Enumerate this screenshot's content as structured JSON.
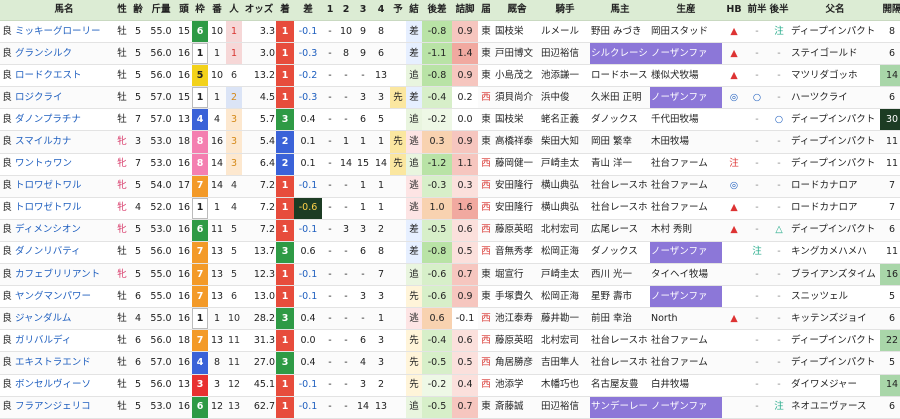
{
  "headers": [
    "",
    "馬名",
    "性",
    "齢",
    "斤量",
    "頭",
    "枠",
    "番",
    "人",
    "オッズ",
    "着",
    "差",
    "1",
    "2",
    "3",
    "4",
    "予",
    "結",
    "後差",
    "詰脚",
    "届",
    "厩舎",
    "騎手",
    "馬主",
    "生産",
    "HB",
    "前半",
    "後半",
    "父名",
    "開隔"
  ],
  "colors": {
    "header_bg": "#dcecd4",
    "link": "#1f5fbf",
    "mare": "#d83a6a",
    "gate1": "#ffffff",
    "gate2": "#222222",
    "gate3": "#e83030",
    "gate4": "#3a62d8",
    "gate5": "#f3d21a",
    "gate6": "#2e9a45",
    "gate7": "#f39a28",
    "gate8": "#f47fb0"
  },
  "rows": [
    {
      "track": "良",
      "name": "ミッキーグローリー",
      "sex": "牡",
      "age": "5",
      "wt": "55.0",
      "heads": "15",
      "waku": "6",
      "ban": "10",
      "pop": "1",
      "odds": "3.3",
      "fin": "1",
      "diff": "-0.1",
      "c1": "-",
      "c2": "10",
      "c3": "9",
      "c4": "8",
      "yo": "",
      "res": "差",
      "kousa": "-0.8",
      "tsume": "0.9",
      "todoke": "東",
      "stable": "国枝栄",
      "jockey": "ルメール",
      "owner": "野田 みづき",
      "breeder": "岡田スタッド",
      "hb": "▲",
      "front": "-",
      "back": "注",
      "sire": "ディープインパクト",
      "gap": "8"
    },
    {
      "track": "良",
      "name": "グランシルク",
      "sex": "牡",
      "age": "5",
      "wt": "56.0",
      "heads": "16",
      "waku": "1",
      "ban": "1",
      "pop": "1",
      "odds": "3.0",
      "fin": "1",
      "diff": "-0.3",
      "c1": "-",
      "c2": "8",
      "c3": "9",
      "c4": "6",
      "yo": "",
      "res": "差",
      "kousa": "-1.1",
      "tsume": "1.4",
      "todoke": "東",
      "stable": "戸田博文",
      "jockey": "田辺裕信",
      "owner": "シルクレーシ",
      "breeder": "ノーザンファ",
      "hb": "▲",
      "front": "-",
      "back": "-",
      "sire": "ステイゴールド",
      "gap": "6"
    },
    {
      "track": "良",
      "name": "ロードクエスト",
      "sex": "牡",
      "age": "5",
      "wt": "56.0",
      "heads": "16",
      "waku": "5",
      "ban": "10",
      "pop": "6",
      "odds": "13.2",
      "fin": "1",
      "diff": "-0.2",
      "c1": "-",
      "c2": "-",
      "c3": "-",
      "c4": "13",
      "yo": "",
      "res": "追",
      "kousa": "-0.8",
      "tsume": "0.9",
      "todoke": "東",
      "stable": "小島茂之",
      "jockey": "池添謙一",
      "owner": "ロードホース",
      "breeder": "様似犬牧場",
      "hb": "▲",
      "front": "-",
      "back": "-",
      "sire": "マツリダゴッホ",
      "gap": "14"
    },
    {
      "track": "良",
      "name": "ロジクライ",
      "sex": "牡",
      "age": "5",
      "wt": "57.0",
      "heads": "15",
      "waku": "1",
      "ban": "1",
      "pop": "2",
      "odds": "4.5",
      "fin": "1",
      "diff": "-0.3",
      "c1": "-",
      "c2": "-",
      "c3": "3",
      "c4": "3",
      "yo": "先",
      "res": "差",
      "kousa": "-0.4",
      "tsume": "0.2",
      "todoke": "西",
      "stable": "須貝尚介",
      "jockey": "浜中俊",
      "owner": "久米田 正明",
      "breeder": "ノーザンファ",
      "hb": "◎",
      "front": "○",
      "back": "-",
      "sire": "ハーツクライ",
      "gap": "6"
    },
    {
      "track": "良",
      "name": "ダノンプラチナ",
      "sex": "牡",
      "age": "7",
      "wt": "57.0",
      "heads": "13",
      "waku": "4",
      "ban": "4",
      "pop": "3",
      "odds": "5.7",
      "fin": "3",
      "diff": "0.4",
      "c1": "-",
      "c2": "-",
      "c3": "6",
      "c4": "5",
      "yo": "",
      "res": "追",
      "kousa": "-0.2",
      "tsume": "0.0",
      "todoke": "東",
      "stable": "国枝栄",
      "jockey": "蛯名正義",
      "owner": "ダノックス",
      "breeder": "千代田牧場",
      "hb": "",
      "front": "-",
      "back": "○",
      "sire": "ディープインパクト",
      "gap": "30"
    },
    {
      "track": "良",
      "name": "スマイルカナ",
      "sex": "牝",
      "age": "3",
      "wt": "53.0",
      "heads": "18",
      "waku": "8",
      "ban": "16",
      "pop": "3",
      "odds": "5.4",
      "fin": "2",
      "diff": "0.1",
      "c1": "-",
      "c2": "1",
      "c3": "1",
      "c4": "1",
      "yo": "先",
      "res": "逃",
      "kousa": "0.3",
      "tsume": "0.9",
      "todoke": "東",
      "stable": "高橋祥泰",
      "jockey": "柴田大知",
      "owner": "岡田 繁幸",
      "breeder": "木田牧場",
      "hb": "",
      "front": "-",
      "back": "-",
      "sire": "ディープインパクト",
      "gap": "11"
    },
    {
      "track": "良",
      "name": "ワントゥワン",
      "sex": "牝",
      "age": "7",
      "wt": "53.0",
      "heads": "16",
      "waku": "8",
      "ban": "14",
      "pop": "3",
      "odds": "6.4",
      "fin": "2",
      "diff": "0.1",
      "c1": "-",
      "c2": "14",
      "c3": "15",
      "c4": "14",
      "yo": "先",
      "res": "追",
      "kousa": "-1.2",
      "tsume": "1.1",
      "todoke": "西",
      "stable": "藤岡健一",
      "jockey": "戸崎圭太",
      "owner": "青山 洋一",
      "breeder": "社台ファーム",
      "hb": "注",
      "front": "-",
      "back": "-",
      "sire": "ディープインパクト",
      "gap": "11"
    },
    {
      "track": "良",
      "name": "トロワゼトワル",
      "sex": "牝",
      "age": "5",
      "wt": "54.0",
      "heads": "17",
      "waku": "7",
      "ban": "14",
      "pop": "4",
      "odds": "7.2",
      "fin": "1",
      "diff": "-0.1",
      "c1": "-",
      "c2": "-",
      "c3": "1",
      "c4": "1",
      "yo": "",
      "res": "逃",
      "kousa": "-0.3",
      "tsume": "0.3",
      "todoke": "西",
      "stable": "安田隆行",
      "jockey": "横山典弘",
      "owner": "社台レースホ",
      "breeder": "社台ファーム",
      "hb": "◎",
      "front": "-",
      "back": "-",
      "sire": "ロードカナロア",
      "gap": "7"
    },
    {
      "track": "良",
      "name": "トロワゼトワル",
      "sex": "牝",
      "age": "4",
      "wt": "52.0",
      "heads": "16",
      "waku": "1",
      "ban": "1",
      "pop": "4",
      "odds": "7.2",
      "fin": "1",
      "diff": "-0.6",
      "c1": "-",
      "c2": "-",
      "c3": "1",
      "c4": "1",
      "yo": "",
      "res": "逃",
      "kousa": "1.0",
      "tsume": "1.6",
      "todoke": "西",
      "stable": "安田隆行",
      "jockey": "横山典弘",
      "owner": "社台レースホ",
      "breeder": "社台ファーム",
      "hb": "▲",
      "front": "-",
      "back": "-",
      "sire": "ロードカナロア",
      "gap": "7"
    },
    {
      "track": "良",
      "name": "ディメンシオン",
      "sex": "牝",
      "age": "5",
      "wt": "53.0",
      "heads": "16",
      "waku": "6",
      "ban": "11",
      "pop": "5",
      "odds": "7.2",
      "fin": "1",
      "diff": "-0.1",
      "c1": "-",
      "c2": "3",
      "c3": "3",
      "c4": "2",
      "yo": "",
      "res": "差",
      "kousa": "-0.5",
      "tsume": "0.6",
      "todoke": "西",
      "stable": "藤原英昭",
      "jockey": "北村宏司",
      "owner": "広尾レース",
      "breeder": "木村 秀則",
      "hb": "▲",
      "front": "-",
      "back": "△",
      "sire": "ディープインパクト",
      "gap": "6"
    },
    {
      "track": "良",
      "name": "ダノンリバティ",
      "sex": "牡",
      "age": "5",
      "wt": "56.0",
      "heads": "16",
      "waku": "7",
      "ban": "13",
      "pop": "5",
      "odds": "13.7",
      "fin": "3",
      "diff": "0.6",
      "c1": "-",
      "c2": "-",
      "c3": "6",
      "c4": "8",
      "yo": "",
      "res": "差",
      "kousa": "-0.8",
      "tsume": "0.5",
      "todoke": "西",
      "stable": "音無秀孝",
      "jockey": "松岡正海",
      "owner": "ダノックス",
      "breeder": "ノーザンファ",
      "hb": "",
      "front": "注",
      "back": "-",
      "sire": "キングカメハメハ",
      "gap": "11"
    },
    {
      "track": "良",
      "name": "カフェブリリアント",
      "sex": "牝",
      "age": "5",
      "wt": "55.0",
      "heads": "16",
      "waku": "7",
      "ban": "13",
      "pop": "5",
      "odds": "12.3",
      "fin": "1",
      "diff": "-0.1",
      "c1": "-",
      "c2": "-",
      "c3": "-",
      "c4": "7",
      "yo": "",
      "res": "追",
      "kousa": "-0.6",
      "tsume": "0.7",
      "todoke": "東",
      "stable": "堀宣行",
      "jockey": "戸崎圭太",
      "owner": "西川 光一",
      "breeder": "タイヘイ牧場",
      "hb": "",
      "front": "-",
      "back": "-",
      "sire": "ブライアンズタイム",
      "gap": "16"
    },
    {
      "track": "良",
      "name": "ヤングマンパワー",
      "sex": "牡",
      "age": "6",
      "wt": "55.0",
      "heads": "16",
      "waku": "7",
      "ban": "13",
      "pop": "6",
      "odds": "13.0",
      "fin": "1",
      "diff": "-0.1",
      "c1": "-",
      "c2": "-",
      "c3": "3",
      "c4": "3",
      "yo": "",
      "res": "先",
      "kousa": "-0.6",
      "tsume": "0.9",
      "todoke": "東",
      "stable": "手塚貴久",
      "jockey": "松岡正海",
      "owner": "星野 壽市",
      "breeder": "ノーザンファ",
      "hb": "",
      "front": "-",
      "back": "-",
      "sire": "スニッツェル",
      "gap": "5"
    },
    {
      "track": "良",
      "name": "ジャンダルム",
      "sex": "牡",
      "age": "4",
      "wt": "55.0",
      "heads": "16",
      "waku": "1",
      "ban": "1",
      "pop": "10",
      "odds": "28.2",
      "fin": "3",
      "diff": "0.4",
      "c1": "-",
      "c2": "-",
      "c3": "-",
      "c4": "1",
      "yo": "",
      "res": "逃",
      "kousa": "0.6",
      "tsume": "-0.1",
      "todoke": "西",
      "stable": "池江泰寿",
      "jockey": "藤井勘一",
      "owner": "前田 幸治",
      "breeder": "North",
      "hb": "▲",
      "front": "-",
      "back": "-",
      "sire": "キッテンズジョイ",
      "gap": "6"
    },
    {
      "track": "良",
      "name": "ガリバルディ",
      "sex": "牡",
      "age": "6",
      "wt": "56.0",
      "heads": "18",
      "waku": "7",
      "ban": "13",
      "pop": "11",
      "odds": "31.3",
      "fin": "1",
      "diff": "0.0",
      "c1": "-",
      "c2": "-",
      "c3": "6",
      "c4": "3",
      "yo": "",
      "res": "先",
      "kousa": "-0.4",
      "tsume": "0.6",
      "todoke": "西",
      "stable": "藤原英昭",
      "jockey": "北村宏司",
      "owner": "社台レースホ",
      "breeder": "社台ファーム",
      "hb": "",
      "front": "-",
      "back": "-",
      "sire": "ディープインパクト",
      "gap": "22"
    },
    {
      "track": "良",
      "name": "エキストラエンド",
      "sex": "牡",
      "age": "6",
      "wt": "57.0",
      "heads": "16",
      "waku": "4",
      "ban": "8",
      "pop": "11",
      "odds": "27.0",
      "fin": "3",
      "diff": "0.4",
      "c1": "-",
      "c2": "-",
      "c3": "4",
      "c4": "3",
      "yo": "",
      "res": "先",
      "kousa": "-0.5",
      "tsume": "0.5",
      "todoke": "西",
      "stable": "角居勝彦",
      "jockey": "吉田隼人",
      "owner": "社台レースホ",
      "breeder": "社台ファーム",
      "hb": "",
      "front": "-",
      "back": "-",
      "sire": "ディープインパクト",
      "gap": "5"
    },
    {
      "track": "良",
      "name": "ボンセルヴィーソ",
      "sex": "牡",
      "age": "5",
      "wt": "56.0",
      "heads": "13",
      "waku": "3",
      "ban": "3",
      "pop": "12",
      "odds": "45.1",
      "fin": "1",
      "diff": "-0.1",
      "c1": "-",
      "c2": "-",
      "c3": "3",
      "c4": "2",
      "yo": "",
      "res": "先",
      "kousa": "-0.2",
      "tsume": "0.4",
      "todoke": "西",
      "stable": "池添学",
      "jockey": "木幡巧也",
      "owner": "名古屋友豊",
      "breeder": "白井牧場",
      "hb": "",
      "front": "-",
      "back": "-",
      "sire": "ダイワメジャー",
      "gap": "14"
    },
    {
      "track": "良",
      "name": "フラアンジェリコ",
      "sex": "牡",
      "age": "5",
      "wt": "53.0",
      "heads": "16",
      "waku": "6",
      "ban": "12",
      "pop": "13",
      "odds": "62.7",
      "fin": "1",
      "diff": "-0.1",
      "c1": "-",
      "c2": "-",
      "c3": "14",
      "c4": "13",
      "yo": "",
      "res": "追",
      "kousa": "-0.5",
      "tsume": "0.7",
      "todoke": "東",
      "stable": "斎藤誠",
      "jockey": "田辺裕信",
      "owner": "サンデーレー",
      "breeder": "ノーザンファ",
      "hb": "",
      "front": "-",
      "back": "注",
      "sire": "ネオユニヴァース",
      "gap": "6"
    }
  ]
}
